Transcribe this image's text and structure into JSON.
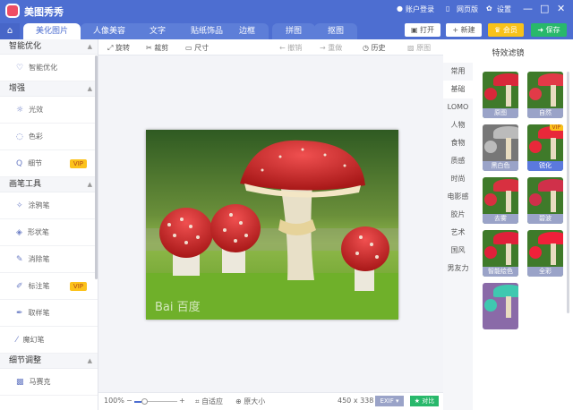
{
  "app": {
    "title": "美图秀秀"
  },
  "header": {
    "login": "账户登录",
    "web": "网页版",
    "settings": "设置",
    "minimize": "—",
    "maximize": "□",
    "close": "✕"
  },
  "tabs": [
    {
      "label": "美化图片"
    },
    {
      "label": "人像美容"
    },
    {
      "label": "文字"
    },
    {
      "label": "贴纸饰品"
    },
    {
      "label": "边框"
    },
    {
      "label": "拼图"
    },
    {
      "label": "抠图"
    }
  ],
  "actions": {
    "open": "打开",
    "new": "+ 新建",
    "vip": "会员",
    "save": "保存"
  },
  "toolbar": {
    "rotate": "旋转",
    "crop": "裁剪",
    "size": "尺寸",
    "undo": "撤销",
    "redo": "重做",
    "history": "历史",
    "original": "原图"
  },
  "sidebar": {
    "sections": [
      {
        "title": "智能优化",
        "items": [
          {
            "label": "智能优化",
            "icon": "bulb-icon"
          }
        ]
      },
      {
        "title": "增强",
        "items": [
          {
            "label": "光效",
            "icon": "sun-icon"
          },
          {
            "label": "色彩",
            "icon": "palette-icon"
          },
          {
            "label": "细节",
            "icon": "magnifier-icon",
            "badge": "VIP"
          }
        ]
      },
      {
        "title": "画笔工具",
        "items": [
          {
            "label": "涂鸦笔",
            "icon": "brush-icon"
          },
          {
            "label": "形状笔",
            "icon": "shape-icon"
          },
          {
            "label": "消除笔",
            "icon": "eraser-icon"
          },
          {
            "label": "标注笔",
            "icon": "pen-icon",
            "badge": "VIP"
          },
          {
            "label": "取样笔",
            "icon": "dropper-icon"
          },
          {
            "label": "魔幻笔",
            "icon": "magic-icon"
          }
        ]
      },
      {
        "title": "细节调整",
        "items": [
          {
            "label": "马赛克",
            "icon": "mosaic-icon"
          }
        ]
      }
    ]
  },
  "canvas": {
    "watermark": "Bai 百度"
  },
  "status": {
    "zoom": "100%",
    "fit": "自适应",
    "actual": "原大小",
    "dimensions": "450 x 338",
    "exif": "EXIF",
    "compare": "对比"
  },
  "filters": {
    "title": "特效滤镜",
    "categories": [
      "常用",
      "基础",
      "LOMO",
      "人物",
      "食物",
      "质感",
      "时尚",
      "电影感",
      "胶片",
      "艺术",
      "国风",
      "男友力"
    ],
    "active_category": "基础",
    "items": [
      {
        "label": "原图"
      },
      {
        "label": "自然"
      },
      {
        "label": "黑白色"
      },
      {
        "label": "锐化",
        "badge": "VIP"
      },
      {
        "label": "去雾"
      },
      {
        "label": "碧波"
      },
      {
        "label": "智能绘色"
      },
      {
        "label": "全彩"
      },
      {
        "label": ""
      }
    ]
  }
}
